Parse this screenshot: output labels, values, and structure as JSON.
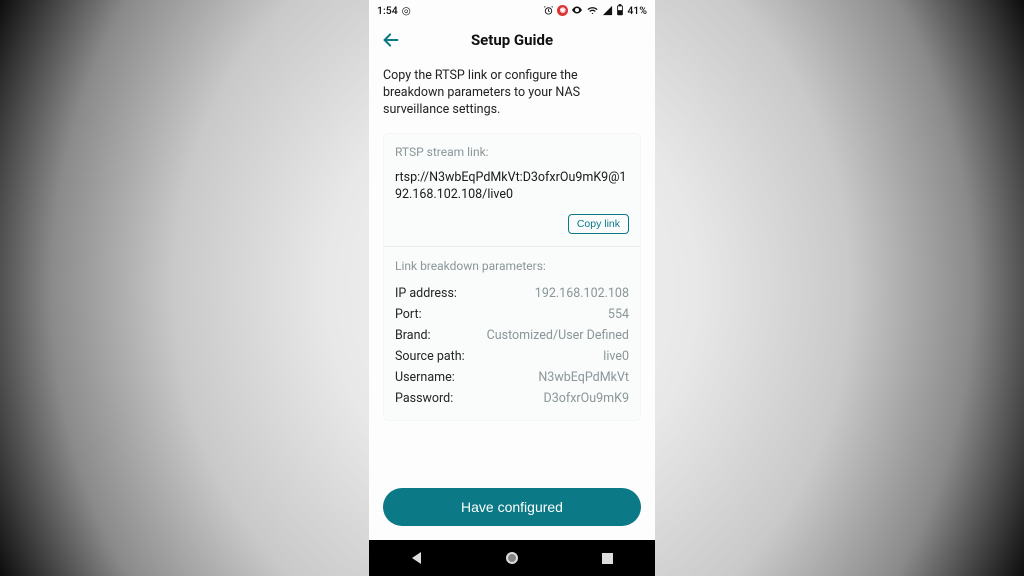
{
  "status": {
    "time": "1:54",
    "battery_text": "41%",
    "icons": {
      "scope": "◎",
      "alarm": "⏰",
      "eye": "◉",
      "wifi": "▾",
      "signal": "◢",
      "battery": "▯"
    }
  },
  "header": {
    "title": "Setup Guide"
  },
  "intro": "Copy the RTSP link or configure the breakdown parameters to your NAS surveillance settings.",
  "rtsp": {
    "label": "RTSP stream link:",
    "url": "rtsp://N3wbEqPdMkVt:D3ofxrOu9mK9@192.168.102.108/live0",
    "copy_label": "Copy link"
  },
  "breakdown": {
    "label": "Link breakdown parameters:",
    "rows": [
      {
        "k": "IP address:",
        "v": "192.168.102.108"
      },
      {
        "k": "Port:",
        "v": "554"
      },
      {
        "k": "Brand:",
        "v": "Customized/User Defined"
      },
      {
        "k": "Source path:",
        "v": "live0"
      },
      {
        "k": "Username:",
        "v": "N3wbEqPdMkVt"
      },
      {
        "k": "Password:",
        "v": "D3ofxrOu9mK9"
      }
    ]
  },
  "cta": {
    "label": "Have configured"
  }
}
